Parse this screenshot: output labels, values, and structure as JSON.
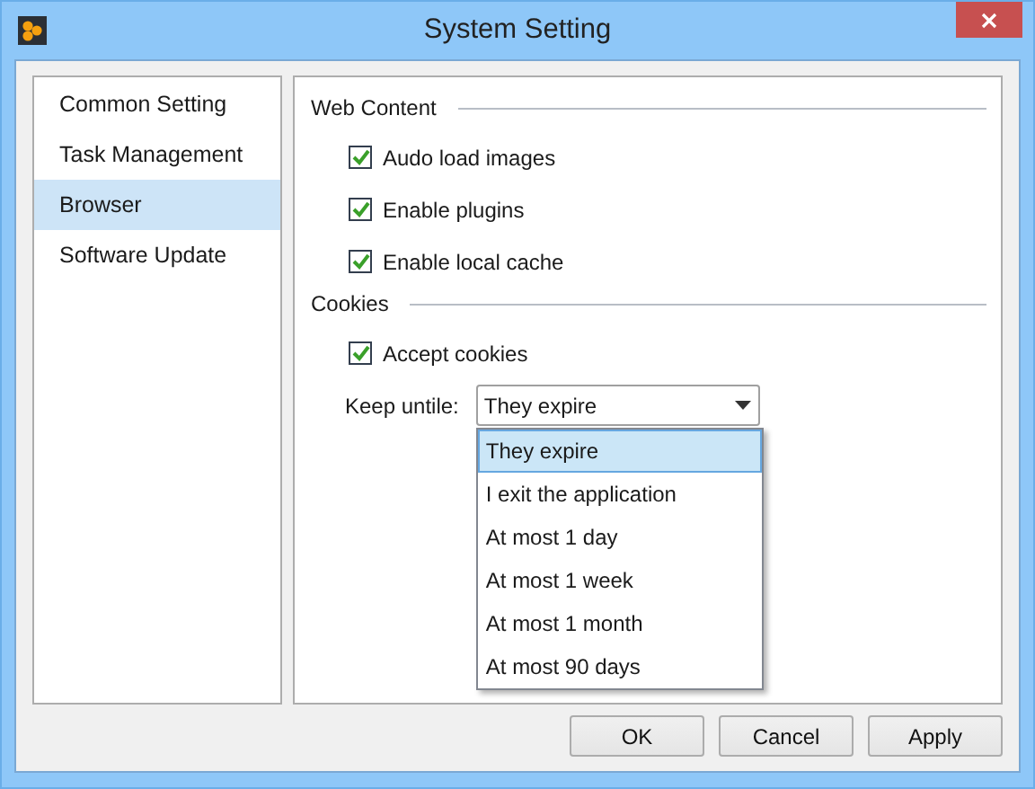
{
  "window": {
    "title": "System Setting"
  },
  "sidebar": {
    "items": [
      {
        "label": "Common Setting",
        "selected": false
      },
      {
        "label": "Task Management",
        "selected": false
      },
      {
        "label": "Browser",
        "selected": true
      },
      {
        "label": "Software Update",
        "selected": false
      }
    ]
  },
  "sections": [
    {
      "title": "Web Content",
      "options": [
        {
          "label": "Audo load images",
          "checked": true
        },
        {
          "label": "Enable plugins",
          "checked": true
        },
        {
          "label": "Enable local cache",
          "checked": true
        }
      ]
    },
    {
      "title": "Cookies",
      "options": [
        {
          "label": "Accept cookies",
          "checked": true
        }
      ]
    }
  ],
  "keep_until": {
    "label": "Keep untile:",
    "value": "They expire",
    "expanded": true,
    "options": [
      {
        "label": "They expire",
        "selected": true
      },
      {
        "label": "I exit the application",
        "selected": false
      },
      {
        "label": "At most 1 day",
        "selected": false
      },
      {
        "label": "At most 1 week",
        "selected": false
      },
      {
        "label": "At most 1 month",
        "selected": false
      },
      {
        "label": "At most 90 days",
        "selected": false
      }
    ]
  },
  "buttons": [
    "OK",
    "Cancel",
    "Apply"
  ]
}
